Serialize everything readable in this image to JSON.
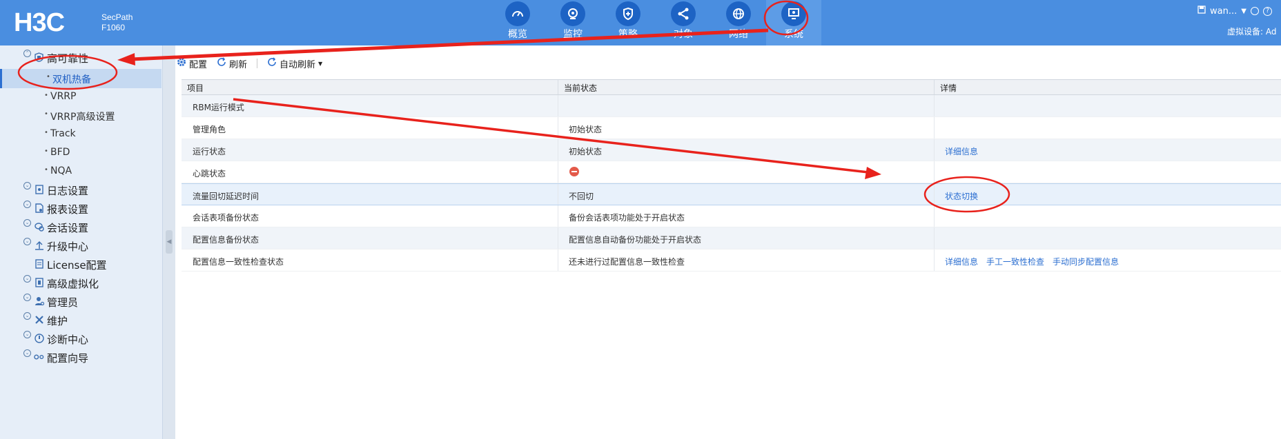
{
  "header": {
    "logo_text": "H3C",
    "product_line1": "SecPath",
    "product_line2": "F1060",
    "nav": [
      {
        "label": "概览",
        "icon": "gauge-icon"
      },
      {
        "label": "监控",
        "icon": "monitor-eye-icon"
      },
      {
        "label": "策略",
        "icon": "shield-plus-icon"
      },
      {
        "label": "对象",
        "icon": "share-nodes-icon"
      },
      {
        "label": "网络",
        "icon": "globe-icon"
      },
      {
        "label": "系统",
        "icon": "system-monitor-icon",
        "active": true
      }
    ],
    "user": "wan...",
    "virtual_device": "虚拟设备: Ad"
  },
  "sidebar": {
    "items": [
      {
        "label": "高可靠性",
        "icon": "reliability-icon",
        "expanded": true
      },
      {
        "label": "日志设置",
        "icon": "log-icon"
      },
      {
        "label": "报表设置",
        "icon": "report-icon"
      },
      {
        "label": "会话设置",
        "icon": "session-icon"
      },
      {
        "label": "升级中心",
        "icon": "upgrade-icon"
      },
      {
        "label": "License配置",
        "icon": "license-icon"
      },
      {
        "label": "高级虚拟化",
        "icon": "virtualization-icon"
      },
      {
        "label": "管理员",
        "icon": "admin-icon"
      },
      {
        "label": "维护",
        "icon": "tools-icon"
      },
      {
        "label": "诊断中心",
        "icon": "diagnose-icon"
      },
      {
        "label": "配置向导",
        "icon": "wizard-icon"
      }
    ],
    "subitems": [
      "双机热备",
      "VRRP",
      "VRRP高级设置",
      "Track",
      "BFD",
      "NQA"
    ]
  },
  "toolbar": {
    "config": "配置",
    "refresh": "刷新",
    "auto_refresh": "自动刷新"
  },
  "table": {
    "headers": [
      "项目",
      "当前状态",
      "详情"
    ],
    "rows": [
      {
        "item": "RBM运行模式",
        "status": "",
        "links": []
      },
      {
        "item": "管理角色",
        "status": "初始状态",
        "links": []
      },
      {
        "item": "运行状态",
        "status": "初始状态",
        "links": [
          "详细信息"
        ]
      },
      {
        "item": "心跳状态",
        "status": "",
        "status_icon": "stop-icon",
        "links": []
      },
      {
        "item": "流量回切延迟时间",
        "status": "不回切",
        "links": [
          "状态切换"
        ]
      },
      {
        "item": "会话表项备份状态",
        "status": "备份会话表项功能处于开启状态",
        "links": []
      },
      {
        "item": "配置信息备份状态",
        "status": "配置信息自动备份功能处于开启状态",
        "links": []
      },
      {
        "item": "配置信息一致性检查状态",
        "status": "还未进行过配置信息一致性检查",
        "links": [
          "详细信息",
          "手工一致性检查",
          "手动同步配置信息"
        ]
      }
    ]
  },
  "colors": {
    "header_bg": "#4a8ee0",
    "nav_icon_bg": "#1d63c4",
    "annotation": "#e8221c",
    "link": "#2c6fd1"
  }
}
